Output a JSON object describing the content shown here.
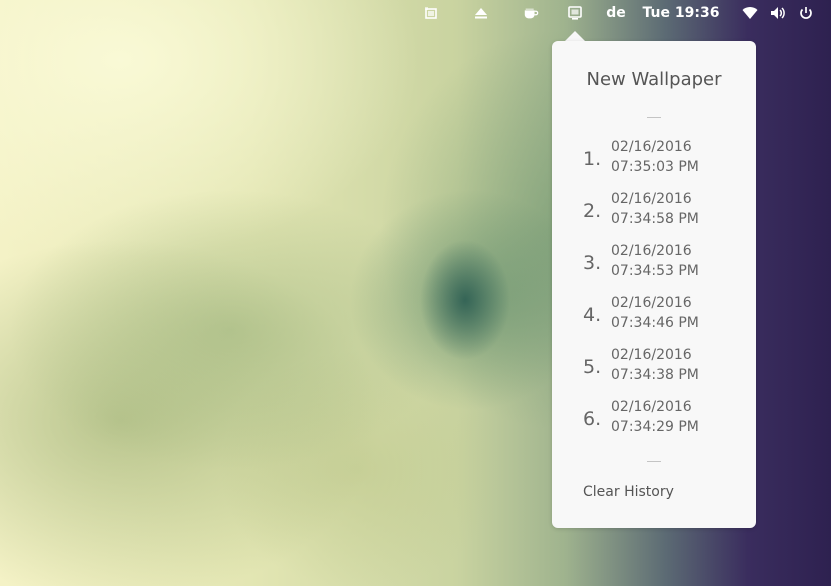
{
  "topbar": {
    "icons": [
      "window-icon",
      "eject-icon",
      "coffee-icon",
      "wallpaper-icon"
    ],
    "language": "de",
    "clock": "Tue 19:36",
    "status_icons": [
      "wifi-icon",
      "volume-icon",
      "power-icon"
    ]
  },
  "popup": {
    "title": "New Wallpaper",
    "history": [
      {
        "num": "1.",
        "date": "02/16/2016",
        "time": "07:35:03 PM"
      },
      {
        "num": "2.",
        "date": "02/16/2016",
        "time": "07:34:58 PM"
      },
      {
        "num": "3.",
        "date": "02/16/2016",
        "time": "07:34:53 PM"
      },
      {
        "num": "4.",
        "date": "02/16/2016",
        "time": "07:34:46 PM"
      },
      {
        "num": "5.",
        "date": "02/16/2016",
        "time": "07:34:38 PM"
      },
      {
        "num": "6.",
        "date": "02/16/2016",
        "time": "07:34:29 PM"
      }
    ],
    "clear_label": "Clear History"
  }
}
